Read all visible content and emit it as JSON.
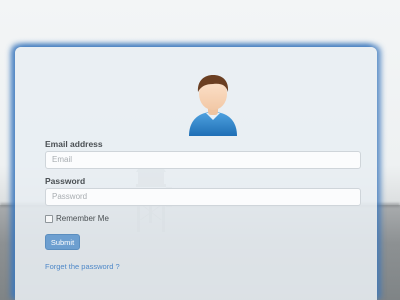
{
  "login": {
    "email_label": "Email address",
    "email_placeholder": "Email",
    "email_value": "",
    "password_label": "Password",
    "password_placeholder": "Password",
    "password_value": "",
    "remember_label": "Remember Me",
    "remember_checked": false,
    "submit_label": "Submit",
    "forgot_link": "Forget the password ?"
  },
  "icons": {
    "avatar": "user-avatar-icon",
    "background": "lighthouse-icon"
  },
  "colors": {
    "accent": "#6d9fd0",
    "link": "#4f88c8",
    "panel_glow": "#3c78be"
  }
}
